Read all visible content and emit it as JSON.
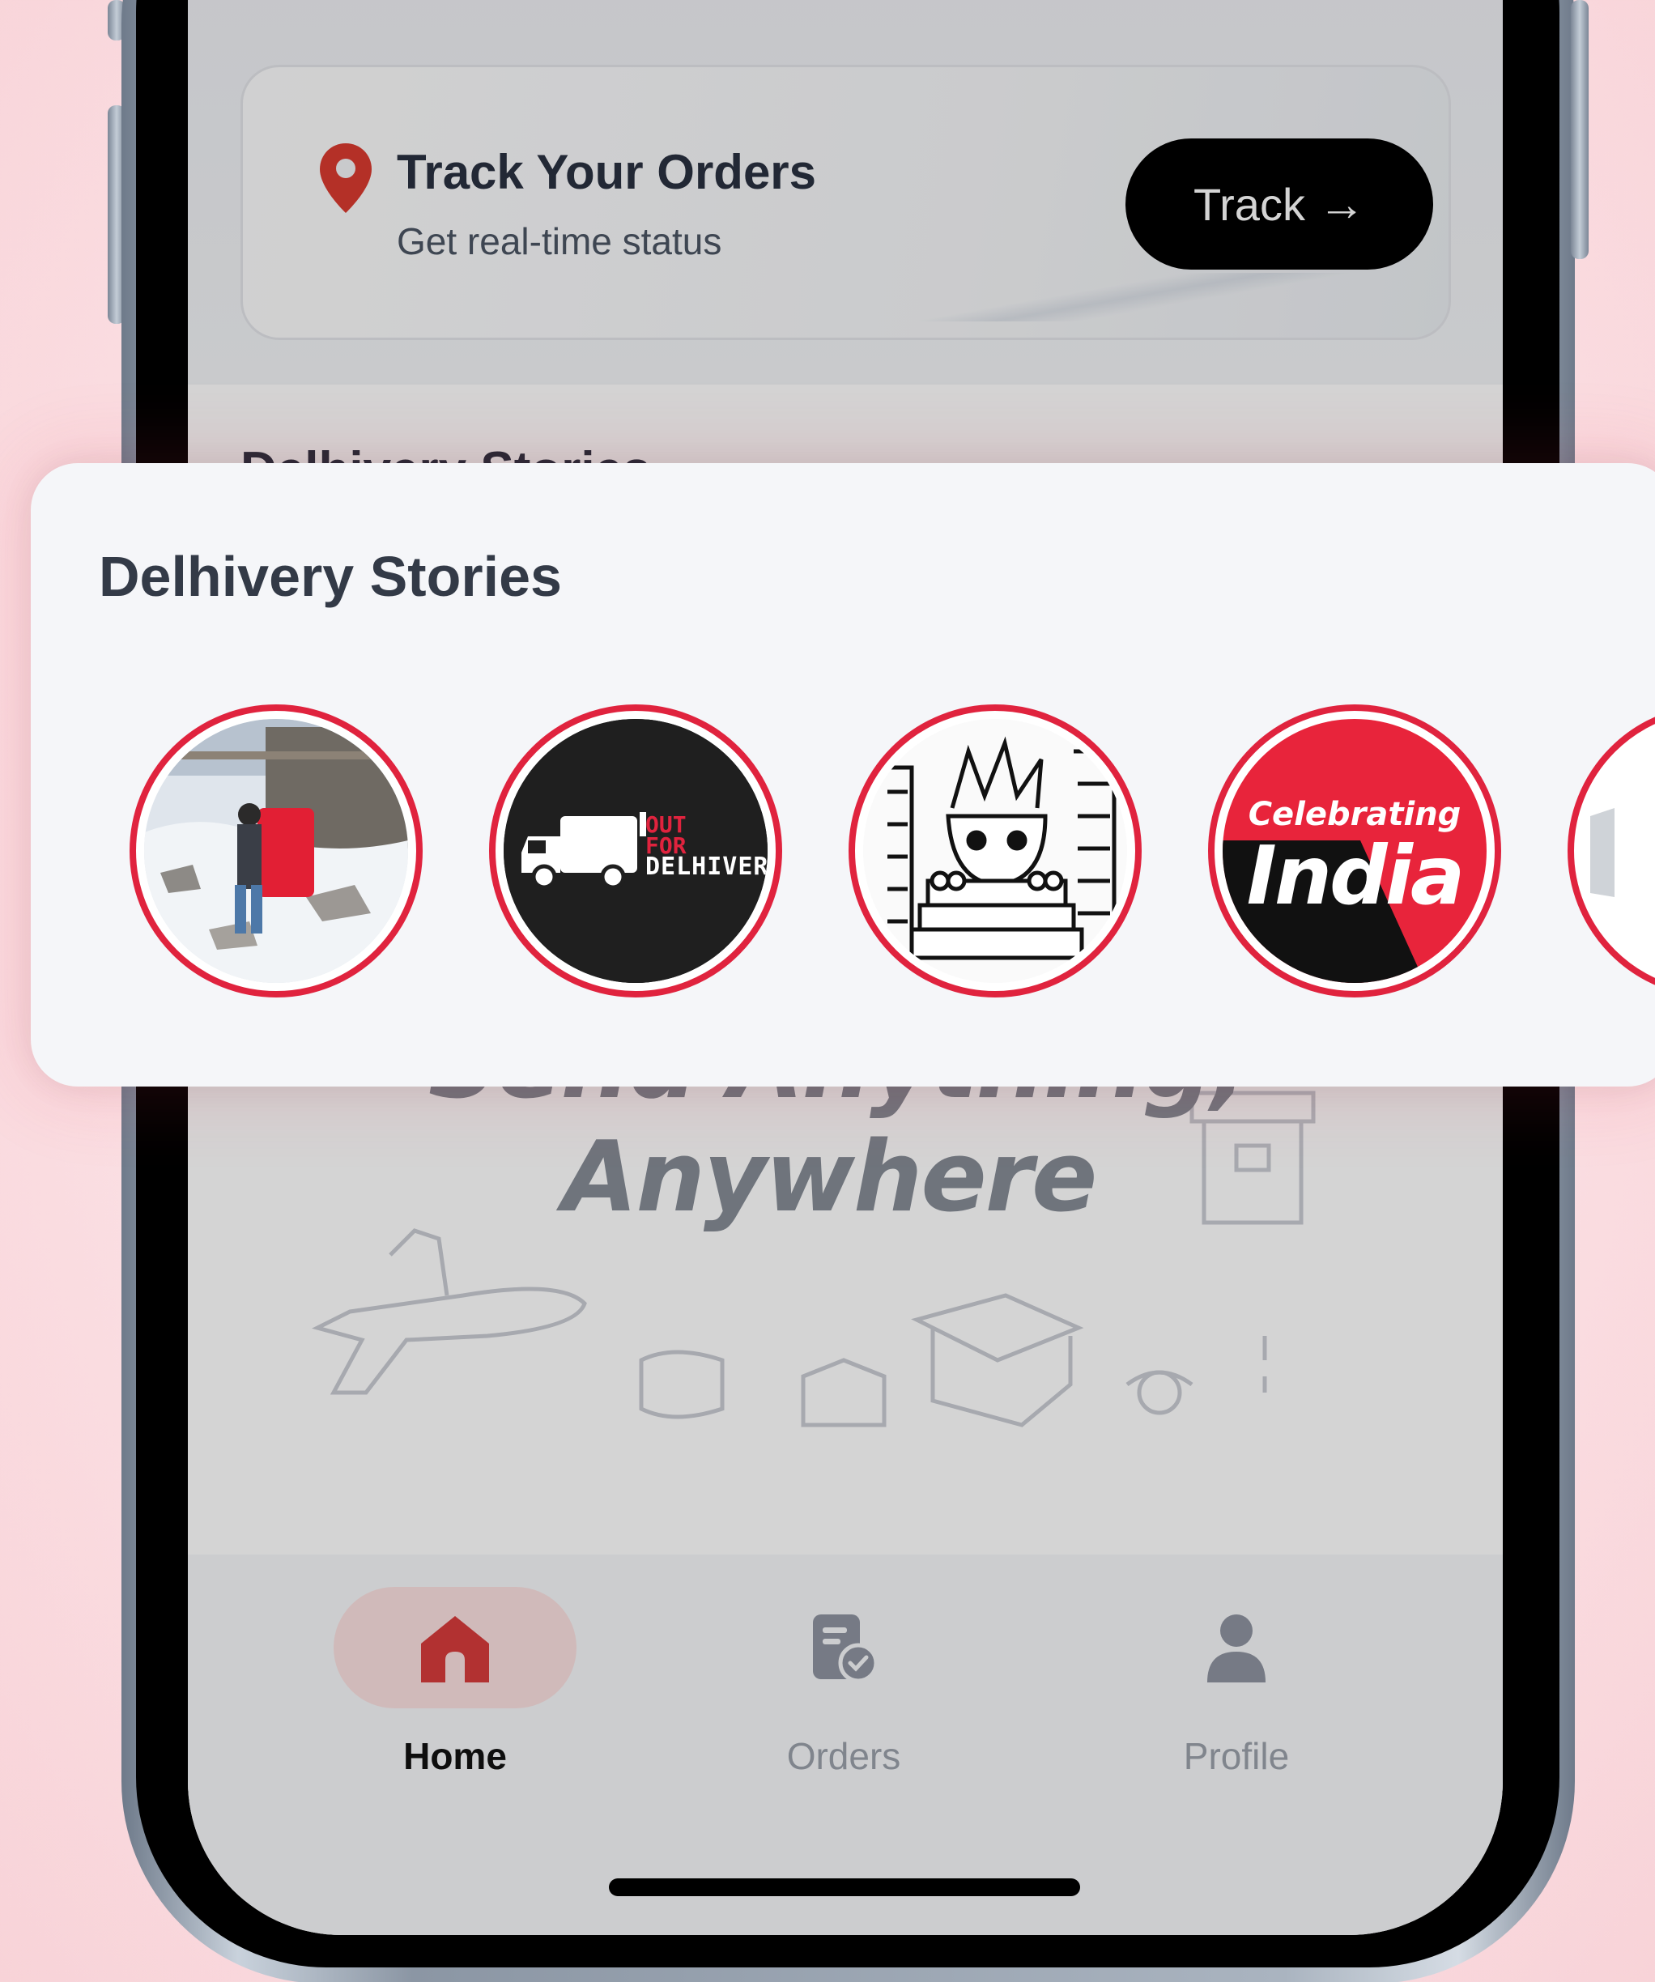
{
  "track_card": {
    "title": "Track Your Orders",
    "subtitle": "Get real-time status",
    "button_label": "Track",
    "button_arrow": "→"
  },
  "stories": {
    "title": "Delhivery Stories",
    "items": [
      {
        "id": "story-1",
        "theme": "snow-delivery-photo"
      },
      {
        "id": "story-2",
        "theme": "out-for-delhivery",
        "line1": "OUT",
        "line2": "FOR",
        "line3": "DELHIVERY"
      },
      {
        "id": "story-3",
        "theme": "comic-illustration"
      },
      {
        "id": "story-4",
        "theme": "celebrating-india",
        "line1": "Celebrating",
        "line2": "India"
      },
      {
        "id": "story-5",
        "theme": "partial"
      }
    ]
  },
  "hero": {
    "line1": "Send Anything,",
    "line2": "Anywhere"
  },
  "nav": {
    "home": "Home",
    "orders": "Orders",
    "profile": "Profile"
  },
  "colors": {
    "accent_red": "#e0233e",
    "home_active": "#d73b3b",
    "inactive_icon": "#8e93a0"
  }
}
